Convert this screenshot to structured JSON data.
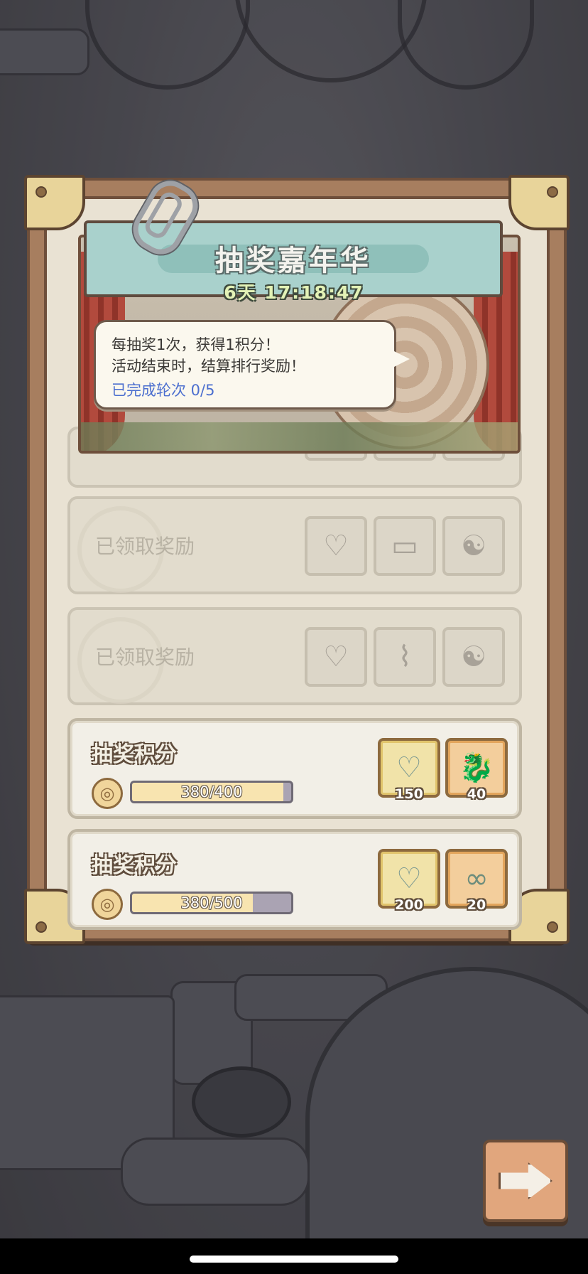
{
  "event": {
    "title": "抽奖嘉年华",
    "countdown": "6天 17:18:47"
  },
  "info": {
    "line1": "每抽奖1次，获得1积分！",
    "line2": "活动结束时，结算排行奖励！",
    "rounds": "已完成轮次 0/5"
  },
  "rows": [
    {
      "state": "claimed",
      "label": "已领取奖励",
      "items": [
        {
          "icon": "balloon-icon",
          "glyph": "♡"
        },
        {
          "icon": "ticket-icon",
          "glyph": "▭"
        },
        {
          "icon": "yin-yang-icon",
          "glyph": "☯"
        }
      ]
    },
    {
      "state": "claimed",
      "label": "已领取奖励",
      "items": [
        {
          "icon": "balloon-icon",
          "glyph": "♡"
        },
        {
          "icon": "cannon-icon",
          "glyph": "⌇"
        },
        {
          "icon": "yin-yang-icon",
          "glyph": "☯"
        }
      ]
    },
    {
      "state": "active",
      "label": "抽奖积分",
      "progress_text": "380/400",
      "progress": 0.95,
      "items": [
        {
          "icon": "balloon-icon",
          "glyph": "♡",
          "qty": "150"
        },
        {
          "icon": "dragon-icon",
          "glyph": "🐉",
          "qty": "40"
        }
      ]
    },
    {
      "state": "active",
      "label": "抽奖积分",
      "progress_text": "380/500",
      "progress": 0.76,
      "items": [
        {
          "icon": "balloon-icon",
          "glyph": "♡",
          "qty": "200"
        },
        {
          "icon": "glasses-icon",
          "glyph": "∞",
          "qty": "20"
        }
      ]
    }
  ],
  "coin_icon": {
    "icon": "spiral-coin-icon",
    "glyph": "◎"
  },
  "colors": {
    "frame": "#a77e5f",
    "title_plate": "#a9d1cc",
    "progress_fill": "#f8e4b0",
    "rounds_text": "#4c6fcf",
    "next_button": "#e1a67d"
  }
}
